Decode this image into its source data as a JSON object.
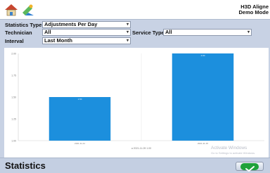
{
  "app": {
    "title_line1": "H3D Aligne",
    "title_line2": "Demo Mode"
  },
  "toolbar": {
    "home_icon": "home-icon",
    "tools_icon": "tools-icon"
  },
  "filters": {
    "statistics_type": {
      "label": "Statistics Type",
      "value": "Adjustments Per Day"
    },
    "technician": {
      "label": "Technician",
      "value": "All"
    },
    "service_type": {
      "label": "Service Type",
      "value": "All"
    },
    "interval": {
      "label": "Interval",
      "value": "Last Month"
    }
  },
  "chart_data": {
    "type": "bar",
    "categories": [
      "2021-11-11",
      "2021-11-15"
    ],
    "values": [
      1.5,
      2.0
    ],
    "ylim": [
      1.0,
      2.0
    ],
    "yticks": [
      "1.00",
      "1.25",
      "1.50",
      "1.75",
      "2.00"
    ],
    "xlabel": "a 2021-11-09 1.00",
    "bar_color": "#1c8fdd",
    "grid": false
  },
  "watermark": {
    "line1": "Activate Windows",
    "line2": "Go to Settings to activate Windows."
  },
  "footer": {
    "title": "Statistics",
    "ok_icon": "checkmark-icon"
  }
}
